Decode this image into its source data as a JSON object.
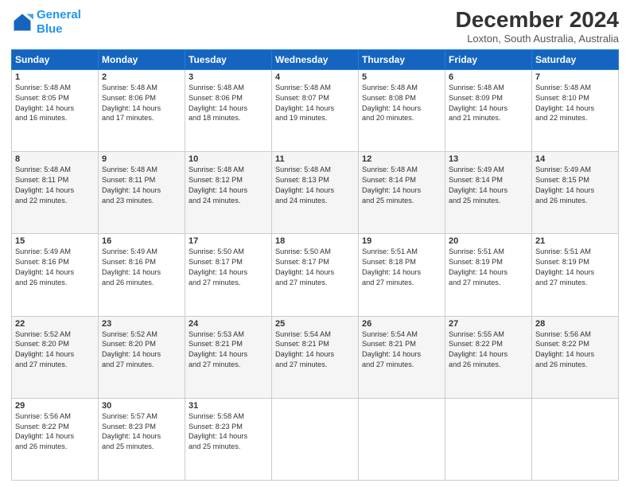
{
  "logo": {
    "line1": "General",
    "line2": "Blue"
  },
  "title": "December 2024",
  "subtitle": "Loxton, South Australia, Australia",
  "days_of_week": [
    "Sunday",
    "Monday",
    "Tuesday",
    "Wednesday",
    "Thursday",
    "Friday",
    "Saturday"
  ],
  "weeks": [
    [
      {
        "day": "1",
        "info": "Sunrise: 5:48 AM\nSunset: 8:05 PM\nDaylight: 14 hours\nand 16 minutes."
      },
      {
        "day": "2",
        "info": "Sunrise: 5:48 AM\nSunset: 8:06 PM\nDaylight: 14 hours\nand 17 minutes."
      },
      {
        "day": "3",
        "info": "Sunrise: 5:48 AM\nSunset: 8:06 PM\nDaylight: 14 hours\nand 18 minutes."
      },
      {
        "day": "4",
        "info": "Sunrise: 5:48 AM\nSunset: 8:07 PM\nDaylight: 14 hours\nand 19 minutes."
      },
      {
        "day": "5",
        "info": "Sunrise: 5:48 AM\nSunset: 8:08 PM\nDaylight: 14 hours\nand 20 minutes."
      },
      {
        "day": "6",
        "info": "Sunrise: 5:48 AM\nSunset: 8:09 PM\nDaylight: 14 hours\nand 21 minutes."
      },
      {
        "day": "7",
        "info": "Sunrise: 5:48 AM\nSunset: 8:10 PM\nDaylight: 14 hours\nand 22 minutes."
      }
    ],
    [
      {
        "day": "8",
        "info": "Sunrise: 5:48 AM\nSunset: 8:11 PM\nDaylight: 14 hours\nand 22 minutes."
      },
      {
        "day": "9",
        "info": "Sunrise: 5:48 AM\nSunset: 8:11 PM\nDaylight: 14 hours\nand 23 minutes."
      },
      {
        "day": "10",
        "info": "Sunrise: 5:48 AM\nSunset: 8:12 PM\nDaylight: 14 hours\nand 24 minutes."
      },
      {
        "day": "11",
        "info": "Sunrise: 5:48 AM\nSunset: 8:13 PM\nDaylight: 14 hours\nand 24 minutes."
      },
      {
        "day": "12",
        "info": "Sunrise: 5:48 AM\nSunset: 8:14 PM\nDaylight: 14 hours\nand 25 minutes."
      },
      {
        "day": "13",
        "info": "Sunrise: 5:49 AM\nSunset: 8:14 PM\nDaylight: 14 hours\nand 25 minutes."
      },
      {
        "day": "14",
        "info": "Sunrise: 5:49 AM\nSunset: 8:15 PM\nDaylight: 14 hours\nand 26 minutes."
      }
    ],
    [
      {
        "day": "15",
        "info": "Sunrise: 5:49 AM\nSunset: 8:16 PM\nDaylight: 14 hours\nand 26 minutes."
      },
      {
        "day": "16",
        "info": "Sunrise: 5:49 AM\nSunset: 8:16 PM\nDaylight: 14 hours\nand 26 minutes."
      },
      {
        "day": "17",
        "info": "Sunrise: 5:50 AM\nSunset: 8:17 PM\nDaylight: 14 hours\nand 27 minutes."
      },
      {
        "day": "18",
        "info": "Sunrise: 5:50 AM\nSunset: 8:17 PM\nDaylight: 14 hours\nand 27 minutes."
      },
      {
        "day": "19",
        "info": "Sunrise: 5:51 AM\nSunset: 8:18 PM\nDaylight: 14 hours\nand 27 minutes."
      },
      {
        "day": "20",
        "info": "Sunrise: 5:51 AM\nSunset: 8:19 PM\nDaylight: 14 hours\nand 27 minutes."
      },
      {
        "day": "21",
        "info": "Sunrise: 5:51 AM\nSunset: 8:19 PM\nDaylight: 14 hours\nand 27 minutes."
      }
    ],
    [
      {
        "day": "22",
        "info": "Sunrise: 5:52 AM\nSunset: 8:20 PM\nDaylight: 14 hours\nand 27 minutes."
      },
      {
        "day": "23",
        "info": "Sunrise: 5:52 AM\nSunset: 8:20 PM\nDaylight: 14 hours\nand 27 minutes."
      },
      {
        "day": "24",
        "info": "Sunrise: 5:53 AM\nSunset: 8:21 PM\nDaylight: 14 hours\nand 27 minutes."
      },
      {
        "day": "25",
        "info": "Sunrise: 5:54 AM\nSunset: 8:21 PM\nDaylight: 14 hours\nand 27 minutes."
      },
      {
        "day": "26",
        "info": "Sunrise: 5:54 AM\nSunset: 8:21 PM\nDaylight: 14 hours\nand 27 minutes."
      },
      {
        "day": "27",
        "info": "Sunrise: 5:55 AM\nSunset: 8:22 PM\nDaylight: 14 hours\nand 26 minutes."
      },
      {
        "day": "28",
        "info": "Sunrise: 5:56 AM\nSunset: 8:22 PM\nDaylight: 14 hours\nand 26 minutes."
      }
    ],
    [
      {
        "day": "29",
        "info": "Sunrise: 5:56 AM\nSunset: 8:22 PM\nDaylight: 14 hours\nand 26 minutes."
      },
      {
        "day": "30",
        "info": "Sunrise: 5:57 AM\nSunset: 8:23 PM\nDaylight: 14 hours\nand 25 minutes."
      },
      {
        "day": "31",
        "info": "Sunrise: 5:58 AM\nSunset: 8:23 PM\nDaylight: 14 hours\nand 25 minutes."
      },
      null,
      null,
      null,
      null
    ]
  ]
}
